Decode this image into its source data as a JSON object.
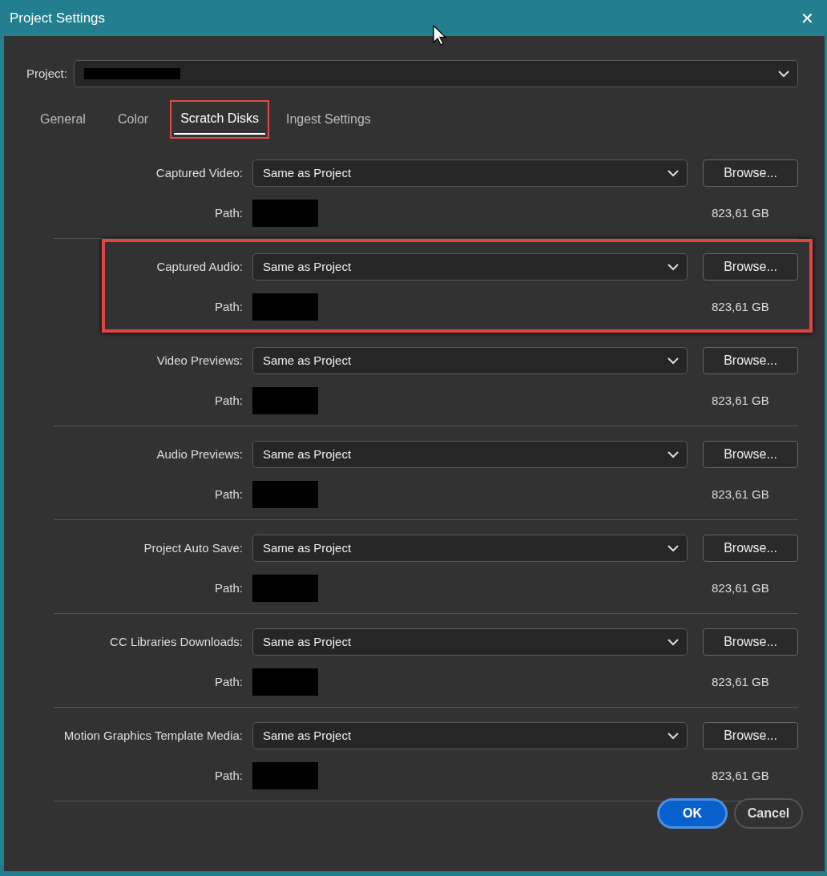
{
  "window": {
    "title": "Project Settings",
    "close": "✕"
  },
  "project": {
    "label": "Project:",
    "redacted": true
  },
  "tabs": [
    {
      "label": "General",
      "selected": false,
      "highlighted": false
    },
    {
      "label": "Color",
      "selected": false,
      "highlighted": false
    },
    {
      "label": "Scratch Disks",
      "selected": true,
      "highlighted": true
    },
    {
      "label": "Ingest Settings",
      "selected": false,
      "highlighted": false
    }
  ],
  "locations": [
    {
      "label": "Captured Video:",
      "value": "Same as Project",
      "button": "Browse...",
      "path_label": "Path:",
      "path_redacted": true,
      "space": "823,61 GB",
      "highlighted": false
    },
    {
      "label": "Captured Audio:",
      "value": "Same as Project",
      "button": "Browse...",
      "path_label": "Path:",
      "path_redacted": true,
      "space": "823,61 GB",
      "highlighted": true
    },
    {
      "label": "Video Previews:",
      "value": "Same as Project",
      "button": "Browse...",
      "path_label": "Path:",
      "path_redacted": true,
      "space": "823,61 GB",
      "highlighted": false
    },
    {
      "label": "Audio Previews:",
      "value": "Same as Project",
      "button": "Browse...",
      "path_label": "Path:",
      "path_redacted": true,
      "space": "823,61 GB",
      "highlighted": false
    },
    {
      "label": "Project Auto Save:",
      "value": "Same as Project",
      "button": "Browse...",
      "path_label": "Path:",
      "path_redacted": true,
      "space": "823,61 GB",
      "highlighted": false
    },
    {
      "label": "CC Libraries Downloads:",
      "value": "Same as Project",
      "button": "Browse...",
      "path_label": "Path:",
      "path_redacted": true,
      "space": "823,61 GB",
      "highlighted": false
    },
    {
      "label": "Motion Graphics Template Media:",
      "value": "Same as Project",
      "button": "Browse...",
      "path_label": "Path:",
      "path_redacted": true,
      "space": "823,61 GB",
      "highlighted": false
    }
  ],
  "buttons": [
    {
      "label": "OK",
      "kind": "primary"
    },
    {
      "label": "Cancel",
      "kind": "secondary"
    }
  ]
}
